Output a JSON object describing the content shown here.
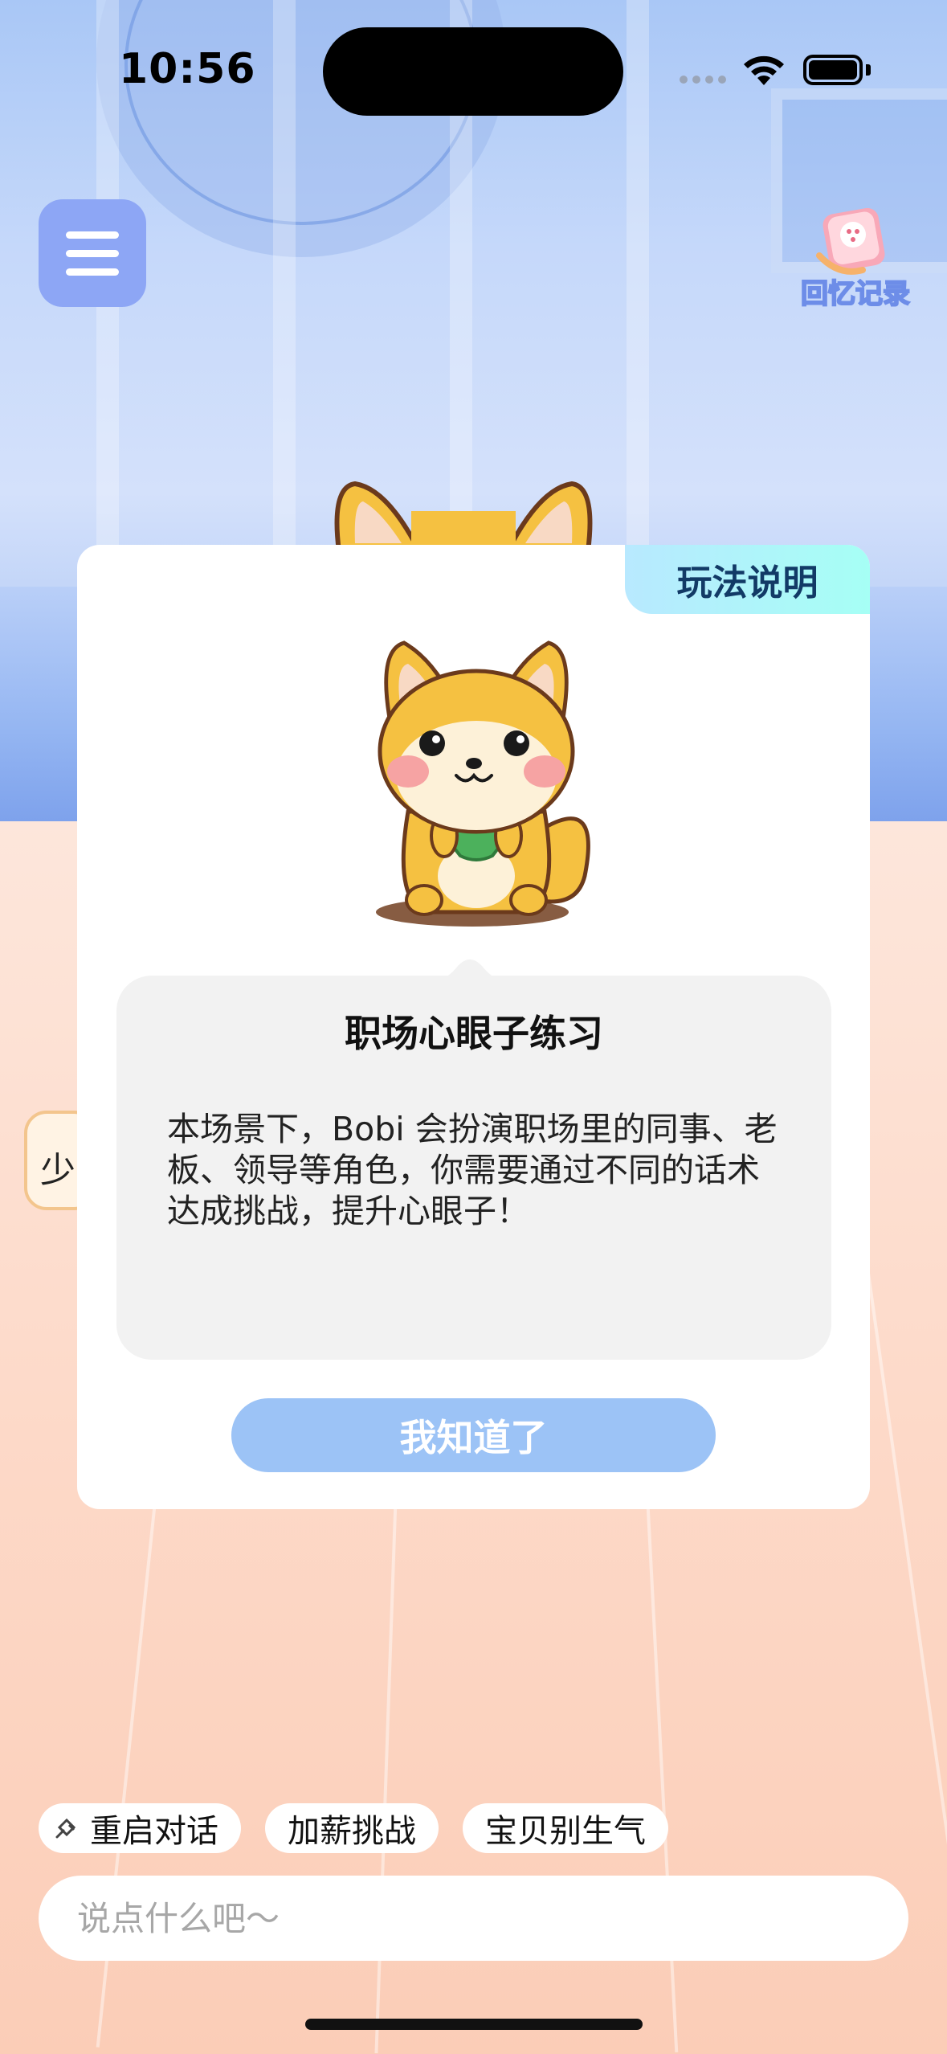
{
  "status_bar": {
    "time": "10:56"
  },
  "header": {
    "menu_icon": "hamburger-menu-icon",
    "memory_label": "回忆记录",
    "memory_icon": "memory-book-icon"
  },
  "side_chip": {
    "label": "少"
  },
  "modal": {
    "tab_label": "玩法说明",
    "mascot": "shiba-dog-mascot",
    "title": "职场心眼子练习",
    "body": "本场景下，Bobi 会扮演职场里的同事、老板、领导等角色，你需要通过不同的话术达成挑战，提升心眼子！",
    "confirm_label": "我知道了"
  },
  "quick_replies": [
    {
      "label": "重启对话",
      "icon": "restart-icon"
    },
    {
      "label": "加薪挑战"
    },
    {
      "label": "宝贝别生气"
    }
  ],
  "input": {
    "placeholder": "说点什么吧～",
    "value": ""
  },
  "colors": {
    "menu_button": "#8da6f5",
    "confirm_button": "#9cc3f6",
    "tab_gradient_start": "#b8e9ff",
    "tab_gradient_end": "#a6fff5",
    "bubble": "#f2f2f2"
  }
}
